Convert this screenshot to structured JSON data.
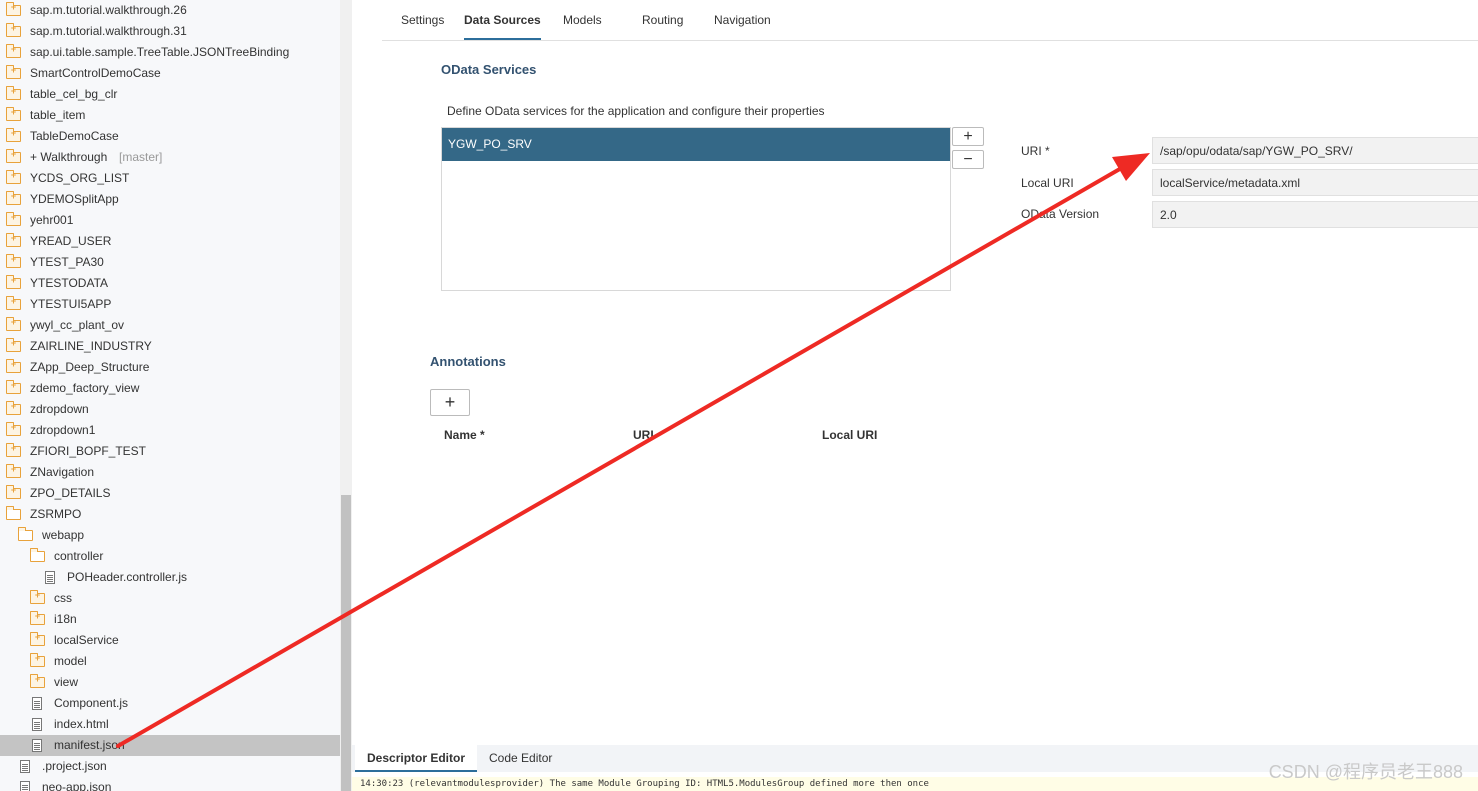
{
  "tree": {
    "items": [
      {
        "label": "sap.m.tutorial.walkthrough.26",
        "icon": "folder-closed-icon",
        "indent": 0
      },
      {
        "label": "sap.m.tutorial.walkthrough.31",
        "icon": "folder-closed-icon",
        "indent": 0
      },
      {
        "label": "sap.ui.table.sample.TreeTable.JSONTreeBinding",
        "icon": "folder-closed-icon",
        "indent": 0
      },
      {
        "label": "SmartControlDemoCase",
        "icon": "folder-closed-icon",
        "indent": 0
      },
      {
        "label": "table_cel_bg_clr",
        "icon": "folder-closed-icon",
        "indent": 0
      },
      {
        "label": "table_item",
        "icon": "folder-closed-icon",
        "indent": 0
      },
      {
        "label": "TableDemoCase",
        "icon": "folder-closed-icon",
        "indent": 0
      },
      {
        "label": "+ Walkthrough",
        "suffix": "[master]",
        "icon": "folder-closed-icon",
        "indent": 0
      },
      {
        "label": "YCDS_ORG_LIST",
        "icon": "folder-closed-icon",
        "indent": 0
      },
      {
        "label": "YDEMOSplitApp",
        "icon": "folder-closed-icon",
        "indent": 0
      },
      {
        "label": "yehr001",
        "icon": "folder-closed-icon",
        "indent": 0
      },
      {
        "label": "YREAD_USER",
        "icon": "folder-closed-icon",
        "indent": 0
      },
      {
        "label": "YTEST_PA30",
        "icon": "folder-closed-icon",
        "indent": 0
      },
      {
        "label": "YTESTODATA",
        "icon": "folder-closed-icon",
        "indent": 0
      },
      {
        "label": "YTESTUI5APP",
        "icon": "folder-closed-icon",
        "indent": 0
      },
      {
        "label": "ywyl_cc_plant_ov",
        "icon": "folder-closed-icon",
        "indent": 0
      },
      {
        "label": "ZAIRLINE_INDUSTRY",
        "icon": "folder-closed-icon",
        "indent": 0
      },
      {
        "label": "ZApp_Deep_Structure",
        "icon": "folder-closed-icon",
        "indent": 0
      },
      {
        "label": "zdemo_factory_view",
        "icon": "folder-closed-icon",
        "indent": 0
      },
      {
        "label": "zdropdown",
        "icon": "folder-closed-icon",
        "indent": 0
      },
      {
        "label": "zdropdown1",
        "icon": "folder-closed-icon",
        "indent": 0
      },
      {
        "label": "ZFIORI_BOPF_TEST",
        "icon": "folder-closed-icon",
        "indent": 0
      },
      {
        "label": "ZNavigation",
        "icon": "folder-closed-icon",
        "indent": 0
      },
      {
        "label": "ZPO_DETAILS",
        "icon": "folder-closed-icon",
        "indent": 0
      },
      {
        "label": "ZSRMPO",
        "icon": "folder-open-icon",
        "indent": 0
      },
      {
        "label": "webapp",
        "icon": "folder-open-icon",
        "indent": 1
      },
      {
        "label": "controller",
        "icon": "folder-open-icon",
        "indent": 2
      },
      {
        "label": "POHeader.controller.js",
        "icon": "file-icon",
        "indent": 3
      },
      {
        "label": "css",
        "icon": "folder-closed-icon",
        "indent": 2
      },
      {
        "label": "i18n",
        "icon": "folder-closed-icon",
        "indent": 2
      },
      {
        "label": "localService",
        "icon": "folder-closed-icon",
        "indent": 2
      },
      {
        "label": "model",
        "icon": "folder-closed-icon",
        "indent": 2
      },
      {
        "label": "view",
        "icon": "folder-closed-icon",
        "indent": 2
      },
      {
        "label": "Component.js",
        "icon": "file-icon",
        "indent": 2
      },
      {
        "label": "index.html",
        "icon": "file-icon",
        "indent": 2
      },
      {
        "label": "manifest.json",
        "icon": "file-icon",
        "indent": 2,
        "selected": true
      },
      {
        "label": ".project.json",
        "icon": "file-icon",
        "indent": 1
      },
      {
        "label": "neo-app.json",
        "icon": "file-icon",
        "indent": 1
      }
    ]
  },
  "tabs": [
    "Settings",
    "Data Sources",
    "Models",
    "Routing",
    "Navigation"
  ],
  "active_tab": "Data Sources",
  "odata": {
    "title": "OData Services",
    "description": "Define OData services for the application and configure their properties",
    "services": [
      "YGW_PO_SRV"
    ],
    "add_label": "+",
    "remove_label": "−",
    "fields": {
      "uri_label": "URI *",
      "uri_value": "/sap/opu/odata/sap/YGW_PO_SRV/",
      "local_uri_label": "Local URI",
      "local_uri_value": "localService/metadata.xml",
      "version_label": "OData Version",
      "version_value": "2.0"
    }
  },
  "annotations": {
    "title": "Annotations",
    "add_label": "+",
    "columns": [
      "Name *",
      "URI",
      "Local URI"
    ]
  },
  "bottom_tabs": [
    "Descriptor Editor",
    "Code Editor"
  ],
  "active_bottom_tab": "Descriptor Editor",
  "console_text": "14:30:23 (relevantmodulesprovider) The same Module Grouping ID: HTML5.ModulesGroup defined more then once",
  "watermark": "CSDN @程序员老王888",
  "colors": {
    "accent": "#2c6e9b",
    "selection": "#346887",
    "arrow": "#ee2a24",
    "folder": "#e8a23b"
  }
}
